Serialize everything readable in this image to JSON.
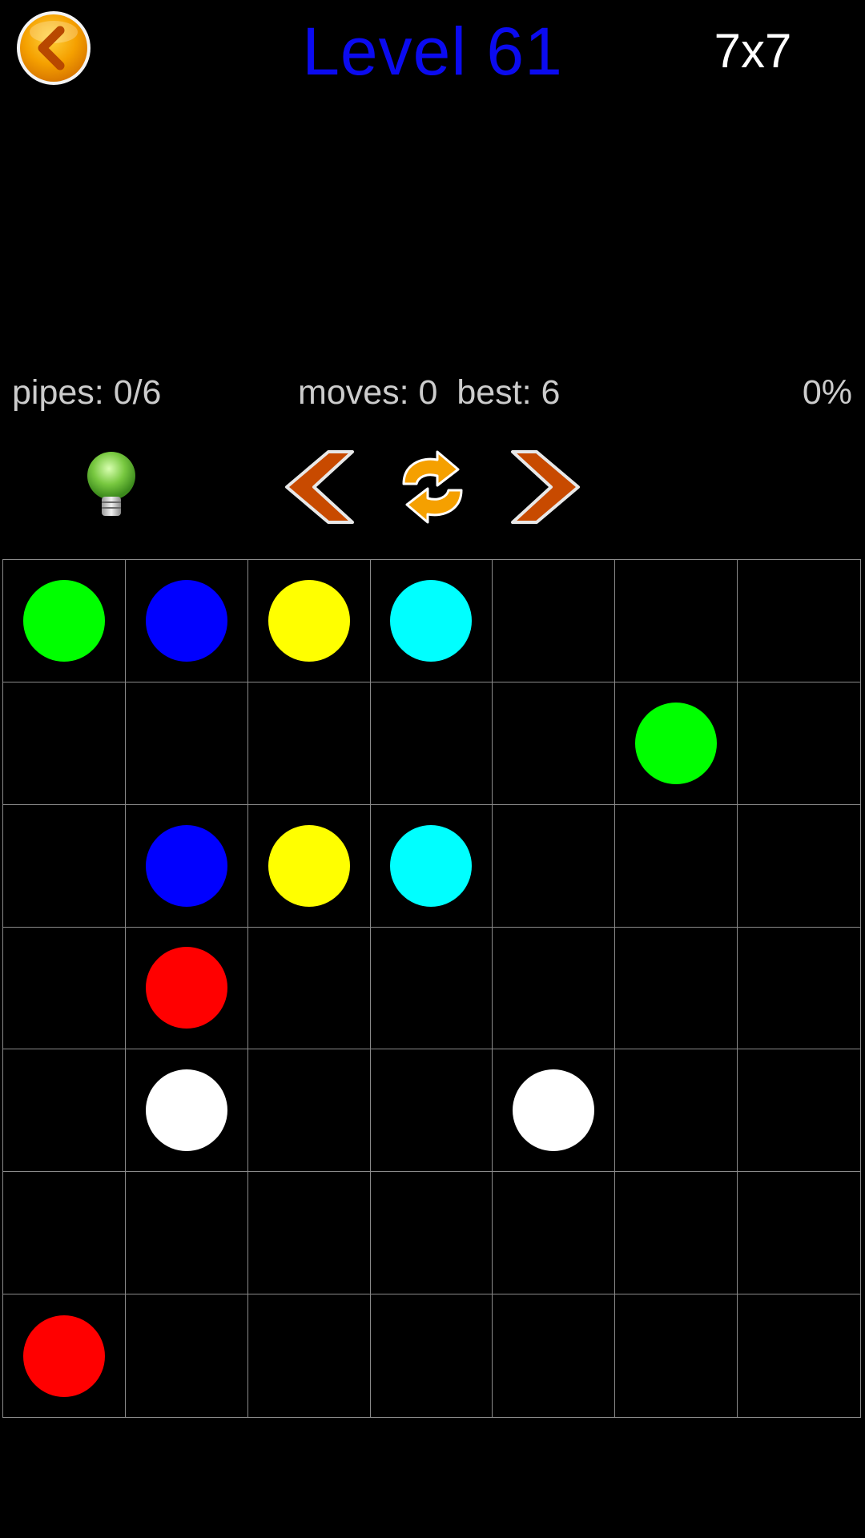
{
  "header": {
    "title": "Level 61",
    "grid_size": "7x7",
    "back_icon": "back-arrow-icon"
  },
  "stats": {
    "pipes": "pipes: 0/6",
    "moves_best": "moves: 0  best: 6",
    "percent": "0%"
  },
  "toolbar": {
    "hint_icon": "lightbulb-icon",
    "prev_icon": "previous-level-icon",
    "restart_icon": "restart-icon",
    "next_icon": "next-level-icon"
  },
  "colors": {
    "green": "#00ff00",
    "blue": "#0000ff",
    "yellow": "#ffff00",
    "cyan": "#00ffff",
    "red": "#ff0000",
    "white": "#ffffff",
    "title_blue": "#0b0bf0",
    "grid_line": "#8a8a8a",
    "button_orange": "#f5a000",
    "arrow_rust": "#c84a00"
  },
  "board": {
    "rows": 7,
    "cols": 7,
    "dots": [
      {
        "row": 0,
        "col": 0,
        "color": "green"
      },
      {
        "row": 0,
        "col": 1,
        "color": "blue"
      },
      {
        "row": 0,
        "col": 2,
        "color": "yellow"
      },
      {
        "row": 0,
        "col": 3,
        "color": "cyan"
      },
      {
        "row": 1,
        "col": 5,
        "color": "green"
      },
      {
        "row": 2,
        "col": 1,
        "color": "blue"
      },
      {
        "row": 2,
        "col": 2,
        "color": "yellow"
      },
      {
        "row": 2,
        "col": 3,
        "color": "cyan"
      },
      {
        "row": 3,
        "col": 1,
        "color": "red"
      },
      {
        "row": 4,
        "col": 1,
        "color": "white"
      },
      {
        "row": 4,
        "col": 4,
        "color": "white"
      },
      {
        "row": 6,
        "col": 0,
        "color": "red"
      }
    ]
  }
}
